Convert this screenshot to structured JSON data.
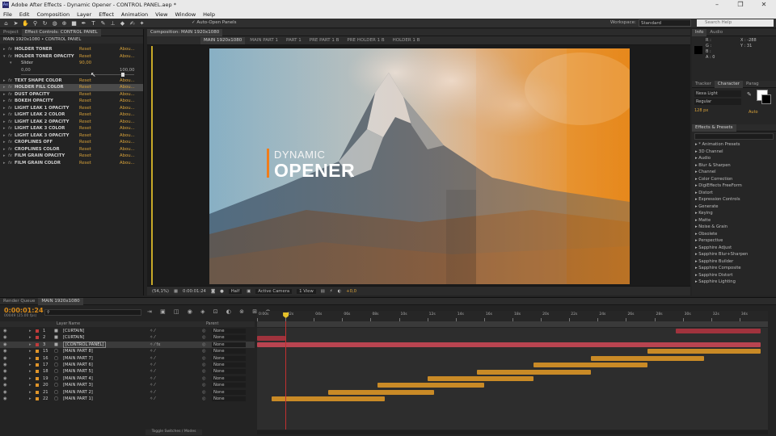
{
  "window": {
    "title": "Adobe After Effects - Dynamic Opener - CONTROL PANEL.aep *",
    "minimize": "–",
    "maximize": "❐",
    "close": "✕"
  },
  "menu": [
    "File",
    "Edit",
    "Composition",
    "Layer",
    "Effect",
    "Animation",
    "View",
    "Window",
    "Help"
  ],
  "toolbar": {
    "auto_open": "Auto-Open Panels",
    "workspace_label": "Workspace:",
    "workspace_value": "Standard",
    "search_placeholder": "Search Help"
  },
  "left_panel": {
    "tabs": [
      "Project",
      "Effect Controls: CONTROL PANEL"
    ],
    "header": "MAIN 1920x1080 • CONTROL PANEL",
    "slider_label": "Slider",
    "slider_value": "90,00",
    "slider_min": "0,00",
    "slider_max": "100,00",
    "slider_level": 0.9,
    "effects": [
      {
        "name": "HOLDER TONER",
        "reset": "Reset",
        "about": "Abou..."
      },
      {
        "name": "HOLDER TONER OPACITY",
        "reset": "Reset",
        "about": "Abou..."
      },
      {
        "name": "TEXT SHAPE COLOR",
        "reset": "Reset",
        "about": "Abou..."
      },
      {
        "name": "HOLDER FILL COLOR",
        "reset": "Reset",
        "about": "Abou..."
      },
      {
        "name": "DUST OPACITY",
        "reset": "Reset",
        "about": "Abou..."
      },
      {
        "name": "BOKEH OPACITY",
        "reset": "Reset",
        "about": "Abou..."
      },
      {
        "name": "LIGHT LEAK 1 OPACITY",
        "reset": "Reset",
        "about": "Abou..."
      },
      {
        "name": "LIGHT LEAK 2 COLOR",
        "reset": "Reset",
        "about": "Abou..."
      },
      {
        "name": "LIGHT LEAK 2 OPACITY",
        "reset": "Reset",
        "about": "Abou..."
      },
      {
        "name": "LIGHT LEAK 3 COLOR",
        "reset": "Reset",
        "about": "Abou..."
      },
      {
        "name": "LIGHT LEAK 3 OPACITY",
        "reset": "Reset",
        "about": "Abou..."
      },
      {
        "name": "CROPLINES OFF",
        "reset": "Reset",
        "about": "Abou..."
      },
      {
        "name": "CROPLINES COLOR",
        "reset": "Reset",
        "about": "Abou..."
      },
      {
        "name": "FILM GRAIN OPACITY",
        "reset": "Reset",
        "about": "Abou..."
      },
      {
        "name": "FILM GRAIN COLOR",
        "reset": "Reset",
        "about": "Abou..."
      }
    ]
  },
  "viewer": {
    "panel_tab": "Composition: MAIN 1920x1080",
    "comp_tabs": [
      "MAIN 1920x1080",
      "MAIN PART 1",
      "PART 1",
      "PRE PART 1 B",
      "PRE HOLDER 1 B",
      "HOLDER 1 B"
    ],
    "title_small": "DYNAMIC",
    "title_big": "OPENER",
    "footer": {
      "zoom": "(54,1%)",
      "timecode": "0:00:01:24",
      "resolution": "Half",
      "camera": "Active Camera",
      "view": "1 View",
      "exposure": "+0,0"
    }
  },
  "info": {
    "tabs": [
      "Info",
      "Audio"
    ],
    "labels": [
      "R :",
      "G :",
      "B :",
      "A : 0"
    ],
    "coords": [
      "X : -288",
      "Y : 31"
    ]
  },
  "character": {
    "tabs": [
      "Tracker",
      "Character",
      "Parag"
    ],
    "font": "Nexa Light",
    "style": "Regular",
    "size": "128 px",
    "auto": "Auto"
  },
  "effects_presets": {
    "tab": "Effects & Presets",
    "items": [
      "* Animation Presets",
      "3D Channel",
      "Audio",
      "Blur & Sharpen",
      "Channel",
      "Color Correction",
      "DigiEffects FreeForm",
      "Distort",
      "Expression Controls",
      "Generate",
      "Keying",
      "Matte",
      "Noise & Grain",
      "Obsolete",
      "Perspective",
      "Sapphire Adjust",
      "Sapphire Blur+Sharpen",
      "Sapphire Builder",
      "Sapphire Composite",
      "Sapphire Distort",
      "Sapphire Lighting"
    ]
  },
  "timeline": {
    "tabs": [
      "Render Queue",
      "MAIN 1920x1080"
    ],
    "timecode": "0:00:01:24",
    "fps": "00049 (25.00 fps)",
    "col_layer_name": "Layer Name",
    "col_parent": "Parent",
    "ticks": [
      "0:00s",
      "02s",
      "04s",
      "06s",
      "08s",
      "10s",
      "12s",
      "14s",
      "16s",
      "18s",
      "20s",
      "22s",
      "24s",
      "26s",
      "28s",
      "30s",
      "32s",
      "34s"
    ],
    "toggle_label": "Toggle Switches / Modes",
    "layers": [
      {
        "num": "1",
        "name": "[CURTAIN]",
        "parent": "None",
        "color": "#c23b3b",
        "bar_start": 29.5,
        "bar_end": 35.5,
        "bar_color": "#a0333d"
      },
      {
        "num": "2",
        "name": "[CURTAIN]",
        "parent": "None",
        "color": "#c23b3b",
        "bar_start": 0.0,
        "bar_end": 2.0,
        "bar_color": "#a0333d"
      },
      {
        "num": "3",
        "name": "[CONTROL PANEL]",
        "parent": "None",
        "color": "#c23b3b",
        "bar_start": 0.0,
        "bar_end": 35.5,
        "bar_color": "#b94450"
      },
      {
        "num": "15",
        "name": "[MAIN PART 8]",
        "parent": "None",
        "color": "#e0952a",
        "bar_start": 27.5,
        "bar_end": 35.5,
        "bar_color": "#c98a26"
      },
      {
        "num": "16",
        "name": "[MAIN PART 7]",
        "parent": "None",
        "color": "#e0952a",
        "bar_start": 23.5,
        "bar_end": 31.5,
        "bar_color": "#c98a26"
      },
      {
        "num": "17",
        "name": "[MAIN PART 6]",
        "parent": "None",
        "color": "#e0952a",
        "bar_start": 19.5,
        "bar_end": 27.5,
        "bar_color": "#c98a26"
      },
      {
        "num": "18",
        "name": "[MAIN PART 5]",
        "parent": "None",
        "color": "#e0952a",
        "bar_start": 15.5,
        "bar_end": 23.5,
        "bar_color": "#c98a26"
      },
      {
        "num": "19",
        "name": "[MAIN PART 4]",
        "parent": "None",
        "color": "#e0952a",
        "bar_start": 12.0,
        "bar_end": 19.5,
        "bar_color": "#c98a26"
      },
      {
        "num": "20",
        "name": "[MAIN PART 3]",
        "parent": "None",
        "color": "#e0952a",
        "bar_start": 8.5,
        "bar_end": 16.0,
        "bar_color": "#c98a26"
      },
      {
        "num": "21",
        "name": "[MAIN PART 2]",
        "parent": "None",
        "color": "#e0952a",
        "bar_start": 5.0,
        "bar_end": 12.5,
        "bar_color": "#c98a26"
      },
      {
        "num": "22",
        "name": "[MAIN PART 1]",
        "parent": "None",
        "color": "#e0952a",
        "bar_start": 1.0,
        "bar_end": 9.0,
        "bar_color": "#c98a26"
      }
    ],
    "playhead_seconds": 2.0
  },
  "colors": {
    "accent": "#d8a23a",
    "timecode": "#d88a1a",
    "selected_layer": "#c23b3b"
  }
}
